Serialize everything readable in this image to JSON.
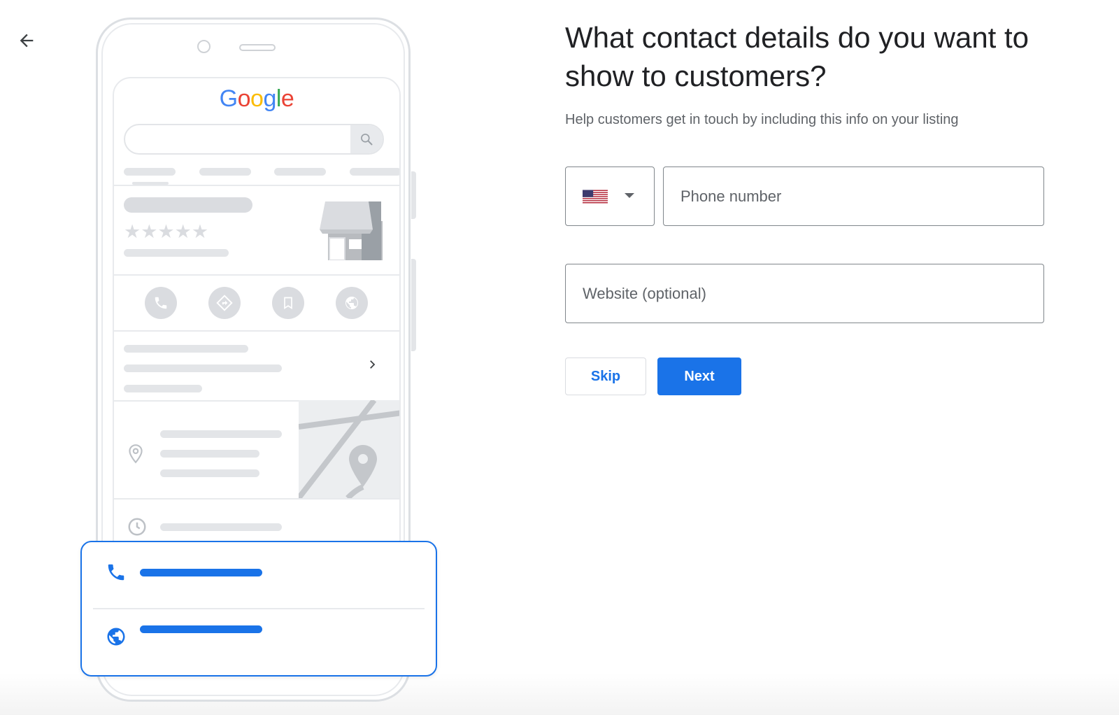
{
  "header": {
    "back_icon": "arrow-left-icon"
  },
  "illustration": {
    "logo_text": "Google",
    "logo_colors": [
      "#4285F4",
      "#EA4335",
      "#FBBC05",
      "#4285F4",
      "#34A853",
      "#EA4335"
    ],
    "rating_stars": 5,
    "action_icons": [
      "phone-icon",
      "directions-icon",
      "bookmark-icon",
      "globe-icon"
    ],
    "card_icons": [
      "phone-icon",
      "globe-icon"
    ],
    "accent_color": "#1a73e8"
  },
  "form": {
    "title": "What contact details do you want to show to customers?",
    "subtitle": "Help customers get in touch by including this info on your listing",
    "country": {
      "selected": "United States",
      "flag_icon": "us-flag-icon"
    },
    "phone": {
      "placeholder": "Phone number",
      "value": ""
    },
    "website": {
      "placeholder": "Website (optional)",
      "value": ""
    },
    "skip_label": "Skip",
    "next_label": "Next",
    "primary_color": "#1a73e8"
  }
}
